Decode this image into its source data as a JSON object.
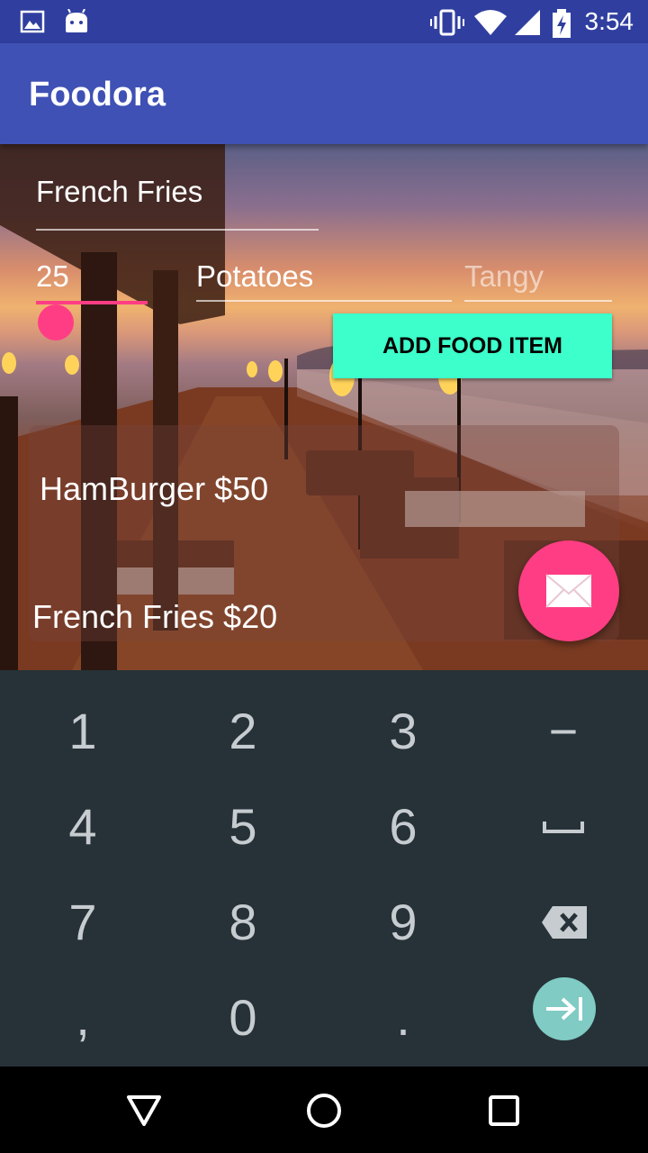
{
  "status_bar": {
    "time": "3:54"
  },
  "app_bar": {
    "title": "Foodora"
  },
  "form": {
    "food_name": "French Fries",
    "add_button_label": "ADD FOOD ITEM",
    "price": "25",
    "ingredient": "Potatoes",
    "taste_placeholder": "Tangy"
  },
  "food_list": [
    {
      "label": "HamBurger $50"
    },
    {
      "label": "French Fries $20"
    }
  ],
  "keyboard": {
    "rows": [
      [
        "1",
        "2",
        "3",
        "−"
      ],
      [
        "4",
        "5",
        "6",
        "space"
      ],
      [
        "7",
        "8",
        "9",
        "backspace"
      ],
      [
        ",",
        "0",
        ".",
        "next"
      ]
    ],
    "key_labels": {
      "k1": "1",
      "k2": "2",
      "k3": "3",
      "k_minus": "−",
      "k4": "4",
      "k5": "5",
      "k6": "6",
      "k7": "7",
      "k8": "8",
      "k9": "9",
      "k_comma": ",",
      "k0": "0",
      "k_period": "."
    },
    "next_key_color": "#80CBC4"
  },
  "colors": {
    "status_bar": "#303F9F",
    "app_bar": "#3F51B5",
    "accent_button": "#3CFFCB",
    "fab": "#FF3D84",
    "keyboard_bg": "#263238"
  }
}
